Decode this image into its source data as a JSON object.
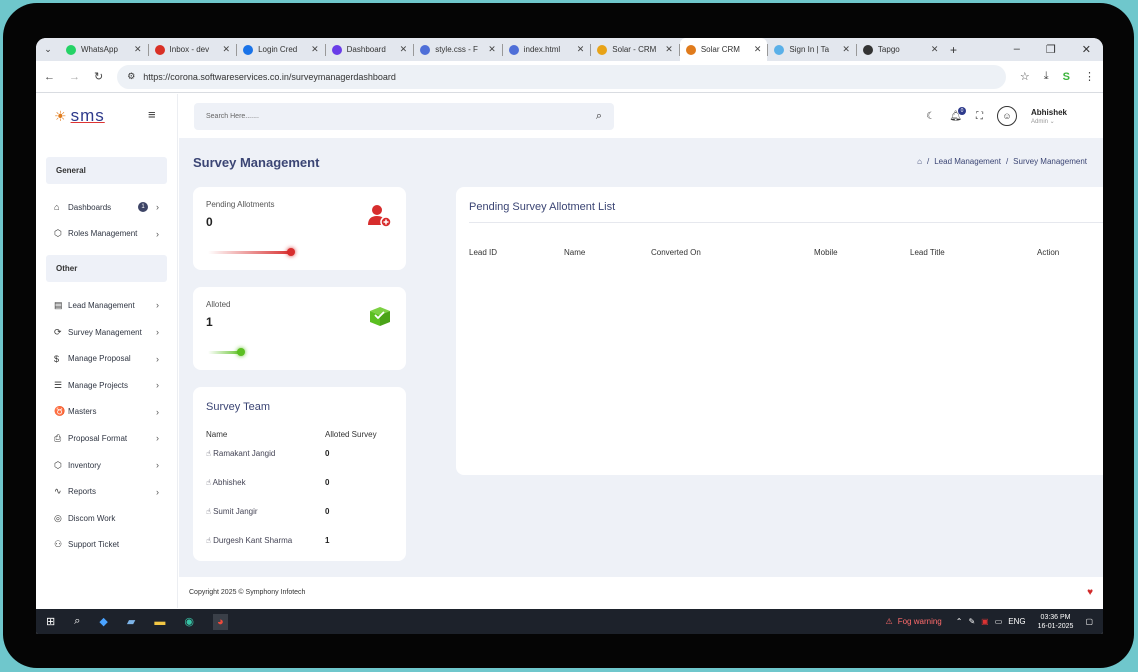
{
  "browser": {
    "tabs": [
      {
        "title": "WhatsApp",
        "color": "#25d366"
      },
      {
        "title": "Inbox - dev",
        "color": "#d93025"
      },
      {
        "title": "Login Cred",
        "color": "#1a73e8"
      },
      {
        "title": "Dashboard",
        "color": "#6a3de8"
      },
      {
        "title": "style.css - F",
        "color": "#4f6fd8"
      },
      {
        "title": "index.html",
        "color": "#4f6fd8"
      },
      {
        "title": "Solar - CRM",
        "color": "#e8a317"
      },
      {
        "title": "Solar CRM",
        "color": "#e07b1c",
        "active": true
      },
      {
        "title": "Sign In | Ta",
        "color": "#5ab0e8"
      },
      {
        "title": "Tapgo",
        "color": "#333333"
      }
    ],
    "url": "https://corona.softwareservices.co.in/surveymanagerdashboard"
  },
  "sidebar": {
    "logo_text": "sms",
    "sections": [
      {
        "title": "General",
        "items": [
          {
            "label": "Dashboards",
            "icon": "home-icon",
            "glyph": "⌂",
            "badge": "1"
          },
          {
            "label": "Roles Management",
            "icon": "cube-icon",
            "glyph": "⬡"
          }
        ]
      },
      {
        "title": "Other",
        "items": [
          {
            "label": "Lead Management",
            "icon": "file-icon",
            "glyph": "▤"
          },
          {
            "label": "Survey Management",
            "icon": "refresh-icon",
            "glyph": "⟳"
          },
          {
            "label": "Manage Proposal",
            "icon": "dollar-icon",
            "glyph": "$"
          },
          {
            "label": "Manage Projects",
            "icon": "server-icon",
            "glyph": "☰"
          },
          {
            "label": "Masters",
            "icon": "puzzle-icon",
            "glyph": "♉"
          },
          {
            "label": "Proposal Format",
            "icon": "printer-icon",
            "glyph": "⎙"
          },
          {
            "label": "Inventory",
            "icon": "box-icon",
            "glyph": "⬡"
          },
          {
            "label": "Reports",
            "icon": "activity-icon",
            "glyph": "∿"
          },
          {
            "label": "Discom Work",
            "icon": "target-icon",
            "glyph": "◎",
            "no_chevron": true
          },
          {
            "label": "Support Ticket",
            "icon": "users-icon",
            "glyph": "⚇",
            "no_chevron": true
          }
        ]
      }
    ]
  },
  "topbar": {
    "search_placeholder": "Search Here.......",
    "user_name": "Abhishek",
    "user_role": "Admin ⌄",
    "notification_count": "0"
  },
  "page": {
    "title": "Survey Management",
    "breadcrumb": [
      "Lead Management",
      "Survey Management"
    ]
  },
  "stats": {
    "pending": {
      "label": "Pending Allotments",
      "value": "0",
      "color": "#d72d2d"
    },
    "alloted": {
      "label": "Alloted",
      "value": "1",
      "color": "#5bbf21"
    }
  },
  "team": {
    "title": "Survey Team",
    "headers": [
      "Name",
      "Alloted Survey"
    ],
    "rows": [
      {
        "name": "Ramakant Jangid",
        "count": "0"
      },
      {
        "name": "Abhishek",
        "count": "0"
      },
      {
        "name": "Sumit Jangir",
        "count": "0"
      },
      {
        "name": "Durgesh Kant Sharma",
        "count": "1"
      }
    ]
  },
  "pending_list": {
    "title": "Pending Survey Allotment List",
    "columns": [
      "Lead ID",
      "Name",
      "Converted On",
      "Mobile",
      "Lead Title",
      "Action"
    ]
  },
  "footer": {
    "text": "Copyright 2025 © Symphony Infotech"
  },
  "taskbar": {
    "weather": "Fog warning",
    "lang": "ENG",
    "time": "03:36 PM",
    "date": "16-01-2025"
  }
}
